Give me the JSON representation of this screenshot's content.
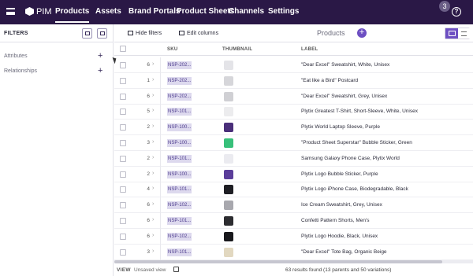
{
  "app": {
    "name": "PIM"
  },
  "nav": [
    {
      "label": "Products",
      "active": true
    },
    {
      "label": "Assets"
    },
    {
      "label": "Brand Portals"
    },
    {
      "label": "Product Sheets"
    },
    {
      "label": "Channels"
    },
    {
      "label": "Settings"
    }
  ],
  "notifications": {
    "count": "3"
  },
  "help": {
    "label": "?"
  },
  "sidebar": {
    "title": "FILTERS",
    "sections": [
      {
        "label": "Attributes"
      },
      {
        "label": "Relationships"
      }
    ],
    "plus": "+"
  },
  "toolbar": {
    "hide_filters": "Hide filters",
    "edit_columns": "Edit columns",
    "page_title": "Products",
    "add": "+"
  },
  "table": {
    "columns": {
      "sku": "SKU",
      "thumbnail": "THUMBNAIL",
      "label": "LABEL"
    },
    "rows": [
      {
        "count": "6",
        "sku": "NSP-202...",
        "label": "\"Dear Excel\" Sweatshirt, White, Unisex",
        "thumb": "#e4e4e8"
      },
      {
        "count": "1",
        "sku": "NSP-202...",
        "label": "\"Eat like a Bird\" Postcard",
        "thumb": "#d6d6da"
      },
      {
        "count": "6",
        "sku": "NSP-202...",
        "label": "\"Dear Excel\" Sweatshirt, Grey, Unisex",
        "thumb": "#d0d0d4"
      },
      {
        "count": "5",
        "sku": "NSP-101...",
        "label": "Plytix Greatest T-Shirt, Short-Sleeve, White, Unisex",
        "thumb": "#ececee"
      },
      {
        "count": "2",
        "sku": "NSP-100...",
        "label": "Plytix World Laptop Sleeve, Purple",
        "thumb": "#4a2f7a"
      },
      {
        "count": "3",
        "sku": "NSP-100...",
        "label": "\"Product Sheet Superstar\" Bubble Sticker, Green",
        "thumb": "#37c07a"
      },
      {
        "count": "2",
        "sku": "NSP-101...",
        "label": "Samsung Galaxy Phone Case, Plytix World",
        "thumb": "#ebebf0"
      },
      {
        "count": "2",
        "sku": "NSP-100...",
        "label": "Plytix Logo Bubble Sticker, Purple",
        "thumb": "#5b3e9a"
      },
      {
        "count": "4",
        "sku": "NSP-101...",
        "label": "Plytix Logo iPhone Case, Biodegradable, Black",
        "thumb": "#1e1e24"
      },
      {
        "count": "6",
        "sku": "NSP-102...",
        "label": "Ice Cream Sweatshirt, Grey, Unisex",
        "thumb": "#a8a8ae"
      },
      {
        "count": "6",
        "sku": "NSP-101...",
        "label": "Confetti Pattern Shorts, Men's",
        "thumb": "#2c2c30"
      },
      {
        "count": "6",
        "sku": "NSP-102...",
        "label": "Plytix Logo Hoodie, Black, Unisex",
        "thumb": "#18181c"
      },
      {
        "count": "3",
        "sku": "NSP-101...",
        "label": "\"Dear Excel\" Tote Bag, Organic Beige",
        "thumb": "#e2d8c0"
      }
    ]
  },
  "footer": {
    "view_label": "VIEW",
    "view_name": "Unsaved view",
    "results": "63 results found (13 parents and 50 variations)"
  },
  "colors": {
    "topbar": "#2a1846",
    "accent": "#6d4fc2",
    "sku_chip": "#ddd9ee"
  }
}
